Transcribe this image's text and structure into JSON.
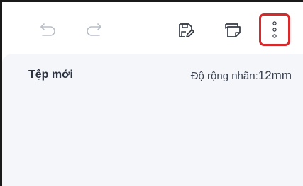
{
  "toolbar": {
    "undo_icon": "undo-arrow-icon",
    "redo_icon": "redo-arrow-icon",
    "save_icon": "save-edit-icon",
    "template_icon": "label-template-icon",
    "more_icon": "more-vertical-dots-icon",
    "highlight_color": "#d9292b",
    "icon_color_active": "#333a44",
    "icon_color_disabled": "#b8bec8"
  },
  "document": {
    "title": "Tệp mới",
    "label_width_caption": "Độ rộng nhãn:",
    "label_width_value": "12mm"
  },
  "colors": {
    "canvas_background": "#f4f6f9"
  }
}
